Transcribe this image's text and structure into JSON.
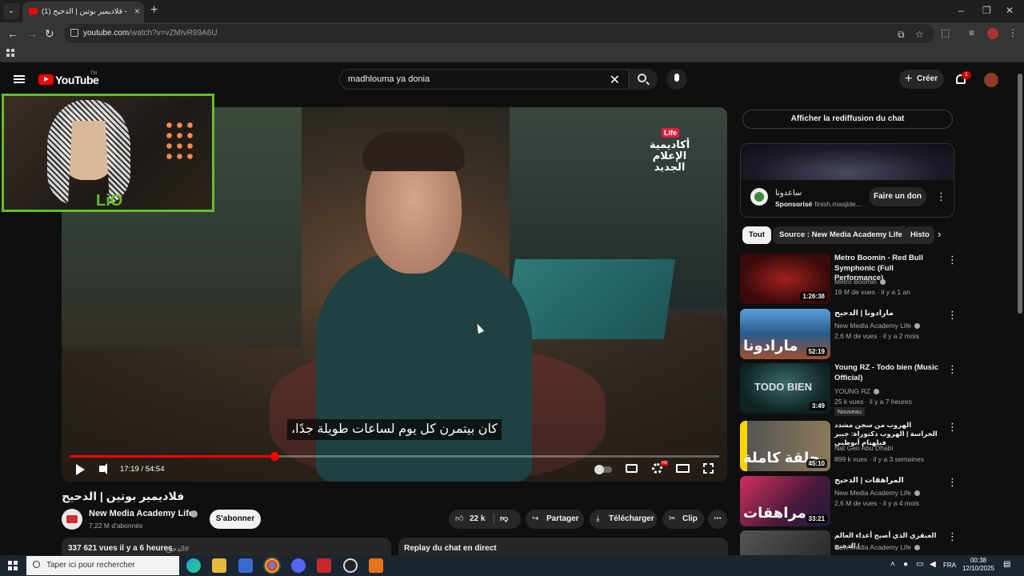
{
  "browser": {
    "tab_title": "(1) فلاديمير بوتين | الدحيح - YouTube",
    "url_host": "youtube.com",
    "url_path": "/watch?v=vZMIvR89A6U",
    "new_tab": "+",
    "tab_close": "×",
    "minimize": "–",
    "restore": "❐",
    "close": "✕"
  },
  "header": {
    "logo_text": "YouTube",
    "logo_region": "TN",
    "search_query": "madhlouma ya donia",
    "create_label": "Créer",
    "notification_count": "1"
  },
  "video": {
    "channel_logo_badge": "Life",
    "channel_logo_text": "أكاديمية الإعلام الجديد",
    "subtitle": "كان بيتمرن كل يوم لساعات طويلة جدًا،",
    "current_time": "17:19",
    "duration": "54:54",
    "progress_fraction": 0.3152,
    "hd_badge": "HD"
  },
  "webcam": {
    "logo": "LiO"
  },
  "info": {
    "title": "فلاديمير بوتين | الدحيح",
    "channel_name": "New Media Academy Life",
    "subscribers": "7,22 M d'abonnés",
    "subscribe_label": "S'abonner",
    "like_count": "22 k",
    "share_label": "Partager",
    "download_label": "Télécharger",
    "clip_label": "Clip",
    "views": "337 621 vues  il y a 6 heures",
    "hashtag": "#الدحيح",
    "chat_replay_label": "Replay du chat en direct"
  },
  "sidebar": {
    "show_chat_label": "Afficher la rediffusion du chat",
    "ad": {
      "title": "ساعدونا",
      "sponsored": "Sponsorisé",
      "domain": "· finish.masjide...",
      "donate_label": "Faire un don"
    },
    "chips": [
      "Tout",
      "Source : New Media Academy Life",
      "Histo"
    ],
    "recommendations": [
      {
        "title": "Metro Boomin - Red Bull Symphonic (Full Performance)",
        "channel": "Metro Boomin",
        "meta": "19 M de vues · il y a 1 an",
        "duration": "1:26:38",
        "thumb_text": "",
        "rtl": false,
        "new": ""
      },
      {
        "title": "ماراﺩﻭﻧﺎ | الدحيح",
        "channel": "New Media Academy Life",
        "meta": "2,6 M de vues · il y a 2 mois",
        "duration": "52:19",
        "thumb_text": "مارادونا",
        "rtl": true,
        "new": ""
      },
      {
        "title": "Young RZ - Todo bien (Music Official)",
        "channel": "YOUNG RZ",
        "meta": "25 k vues · il y a 7 heures",
        "duration": "3:49",
        "thumb_text": "TODO BIEN",
        "rtl": false,
        "new": "Nouveau"
      },
      {
        "title": "الهروب من سجن مشدد الحراسة | الهروب دكتوراة: جيبر فيلهنام أبوظبي",
        "channel": "Nat Geo Abu Dhabi",
        "meta": "899 k vues · il y a 3 semaines",
        "duration": "45:10",
        "thumb_text": "حلقة كاملة",
        "rtl": true,
        "new": ""
      },
      {
        "title": "المراهقات | الدحيح",
        "channel": "New Media Academy Life",
        "meta": "2,6 M de vues · il y a 4 mois",
        "duration": "33:21",
        "thumb_text": "مراهقات",
        "rtl": true,
        "new": ""
      },
      {
        "title": "العبقري الذي أصبح أعداء العالم | الدحيح",
        "channel": "New Media Academy Life",
        "meta": "",
        "duration": "",
        "thumb_text": "",
        "rtl": true,
        "new": ""
      }
    ]
  },
  "taskbar": {
    "search_placeholder": "Taper ici pour rechercher",
    "lang": "FRA",
    "time": "00:38",
    "date": "12/10/2025"
  }
}
